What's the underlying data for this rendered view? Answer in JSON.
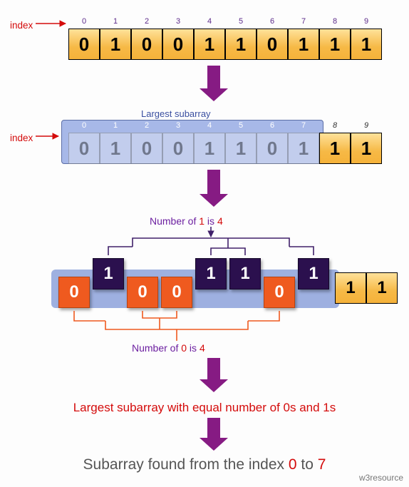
{
  "labels": {
    "index": "index",
    "largest_subarray": "Largest subarray",
    "ones_count_pre": "Number of ",
    "ones_glyph": "1",
    "ones_count_mid": " is ",
    "ones_count_val": "4",
    "zeros_count_pre": "Number of ",
    "zeros_glyph": "0",
    "zeros_count_mid": " is ",
    "zeros_count_val": "4",
    "summary1": "Largest subarray with equal number of 0s and 1s",
    "summary2_pre": "Subarray found from the index ",
    "summary2_from": "0",
    "summary2_mid": " to ",
    "summary2_to": "7",
    "watermark": "w3resource"
  },
  "array": {
    "indices": [
      "0",
      "1",
      "2",
      "3",
      "4",
      "5",
      "6",
      "7",
      "8",
      "9"
    ],
    "values": [
      "0",
      "1",
      "0",
      "0",
      "1",
      "1",
      "0",
      "1",
      "1",
      "1"
    ]
  },
  "stage2": {
    "sub_indices": [
      "0",
      "1",
      "2",
      "3",
      "4",
      "5",
      "6",
      "7"
    ],
    "tail_indices": [
      "8",
      "9"
    ],
    "values": [
      "0",
      "1",
      "0",
      "0",
      "1",
      "1",
      "0",
      "1",
      "1",
      "1"
    ]
  },
  "stage3": {
    "pieces": [
      {
        "v": "0",
        "k": 0
      },
      {
        "v": "1",
        "k": 1
      },
      {
        "v": "0",
        "k": 0
      },
      {
        "v": "0",
        "k": 0
      },
      {
        "v": "1",
        "k": 1
      },
      {
        "v": "1",
        "k": 1
      },
      {
        "v": "0",
        "k": 0
      },
      {
        "v": "1",
        "k": 1
      }
    ],
    "tail": [
      "1",
      "1"
    ]
  },
  "chart_data": {
    "type": "table",
    "title": "Largest subarray with equal number of 0s and 1s",
    "input_array": [
      0,
      1,
      0,
      0,
      1,
      1,
      0,
      1,
      1,
      1
    ],
    "subarray_range": {
      "from": 0,
      "to": 7
    },
    "counts_in_subarray": {
      "ones": 4,
      "zeros": 4
    }
  }
}
